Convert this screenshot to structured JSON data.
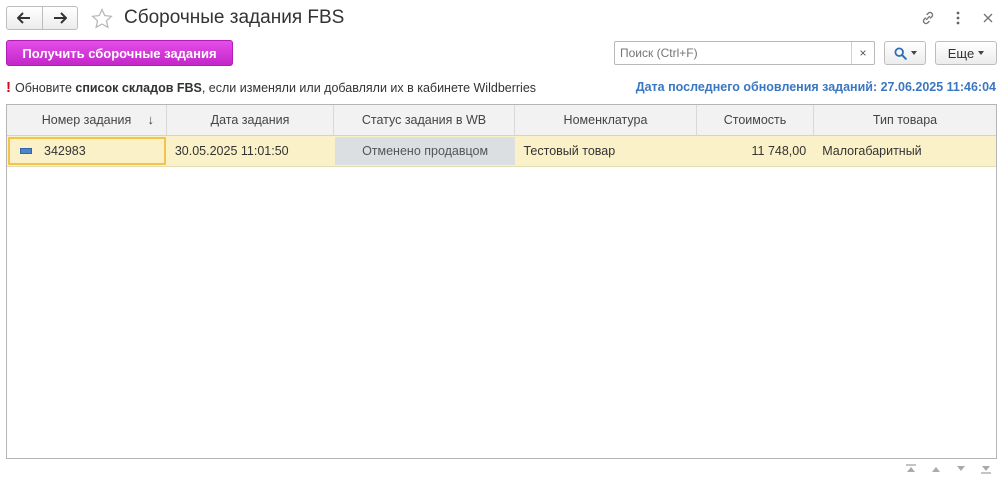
{
  "window": {
    "title": "Сборочные задания FBS",
    "back_icon": "arrow-left-icon",
    "forward_icon": "arrow-right-icon",
    "favorite_icon": "star-icon",
    "link_icon": "link-icon",
    "menu_icon": "kebab-menu-icon",
    "close_icon": "close-icon"
  },
  "toolbar": {
    "get_tasks_label": "Получить сборочные задания",
    "search_placeholder": "Поиск (Ctrl+F)",
    "search_clear": "×",
    "more_label": "Еще"
  },
  "notice": {
    "mark": "!",
    "prefix": "Обновите ",
    "bold": "список складов FBS",
    "suffix": ", если изменяли или добавляли их в кабинете Wildberries"
  },
  "last_update": "Дата последнего обновления заданий: 27.06.2025 11:46:04",
  "table": {
    "columns": [
      "Номер задания",
      "Дата задания",
      "Статус задания в WB",
      "Номенклатура",
      "Стоимость",
      "Тип товара"
    ],
    "sort_indicator": "↓",
    "rows": [
      {
        "number": "342983",
        "date": "30.05.2025 11:01:50",
        "status": "Отменено продавцом",
        "item": "Тестовый товар",
        "cost": "11 748,00",
        "type": "Малогабаритный"
      }
    ]
  },
  "colors": {
    "primary_button": "#d63adc",
    "selected_row": "#fbf1c8",
    "selection_border": "#f3c34b",
    "update_text": "#3a77c2",
    "warning": "#e0001b"
  }
}
